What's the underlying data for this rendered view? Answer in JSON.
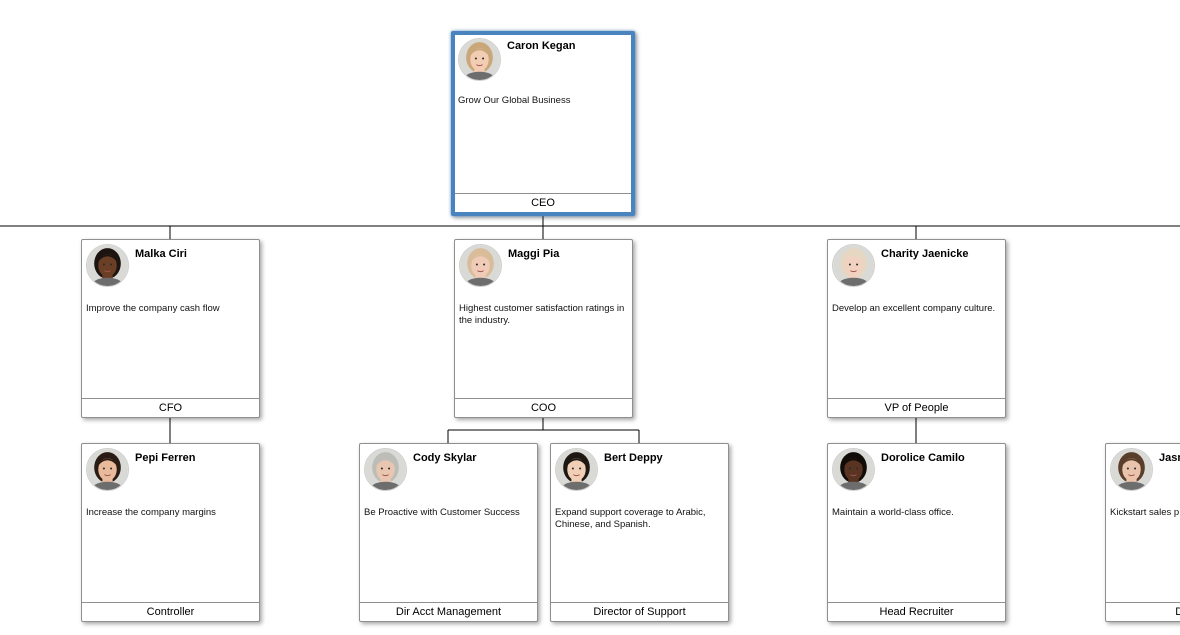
{
  "org_chart": {
    "nodes": [
      {
        "id": "caron",
        "name": "Caron Kegan",
        "description": "Grow Our Global Business",
        "title": "CEO",
        "selected": true,
        "avatar": {
          "skin": "#f2cdb4",
          "hair": "#c9a779"
        }
      },
      {
        "id": "malka",
        "name": "Malka Ciri",
        "description": "Improve the company cash flow",
        "title": "CFO",
        "selected": false,
        "avatar": {
          "skin": "#6b3e26",
          "hair": "#1c1410"
        }
      },
      {
        "id": "maggi",
        "name": "Maggi Pia",
        "description": "Highest customer satisfaction ratings in the industry.",
        "title": "COO",
        "selected": false,
        "avatar": {
          "skin": "#f0ccb8",
          "hair": "#d9bd9a"
        }
      },
      {
        "id": "charity",
        "name": "Charity Jaenicke",
        "description": "Develop an excellent company culture.",
        "title": "VP of People",
        "selected": false,
        "avatar": {
          "skin": "#f1d2c0",
          "hair": "#e6d7c2"
        }
      },
      {
        "id": "pepi",
        "name": "Pepi Ferren",
        "description": "Increase the company margins",
        "title": "Controller",
        "selected": false,
        "avatar": {
          "skin": "#e8b99a",
          "hair": "#2a1c14"
        }
      },
      {
        "id": "cody",
        "name": "Cody Skylar",
        "description": "Be Proactive with Customer Success",
        "title": "Dir Acct Management",
        "selected": false,
        "avatar": {
          "skin": "#e9c6b0",
          "hair": "#bdbdb8"
        }
      },
      {
        "id": "bert",
        "name": "Bert Deppy",
        "description": "Expand support coverage to Arabic, Chinese, and Spanish.",
        "title": "Director of Support",
        "selected": false,
        "avatar": {
          "skin": "#f0cfb6",
          "hair": "#1e1812"
        }
      },
      {
        "id": "dorolice",
        "name": "Dorolice Camilo",
        "description": "Maintain a world-class office.",
        "title": "Head Recruiter",
        "selected": false,
        "avatar": {
          "skin": "#5a3422",
          "hair": "#120c09"
        }
      },
      {
        "id": "jasm",
        "name": "Jasm",
        "description": "Kickstart sales p indicator improve",
        "title": "Director",
        "selected": false,
        "avatar": {
          "skin": "#e9c3ac",
          "hair": "#5a3e2c"
        }
      }
    ]
  },
  "colors": {
    "selected_border": "#4a84bf",
    "card_border": "#8f8f8f",
    "connector": "#000000"
  }
}
